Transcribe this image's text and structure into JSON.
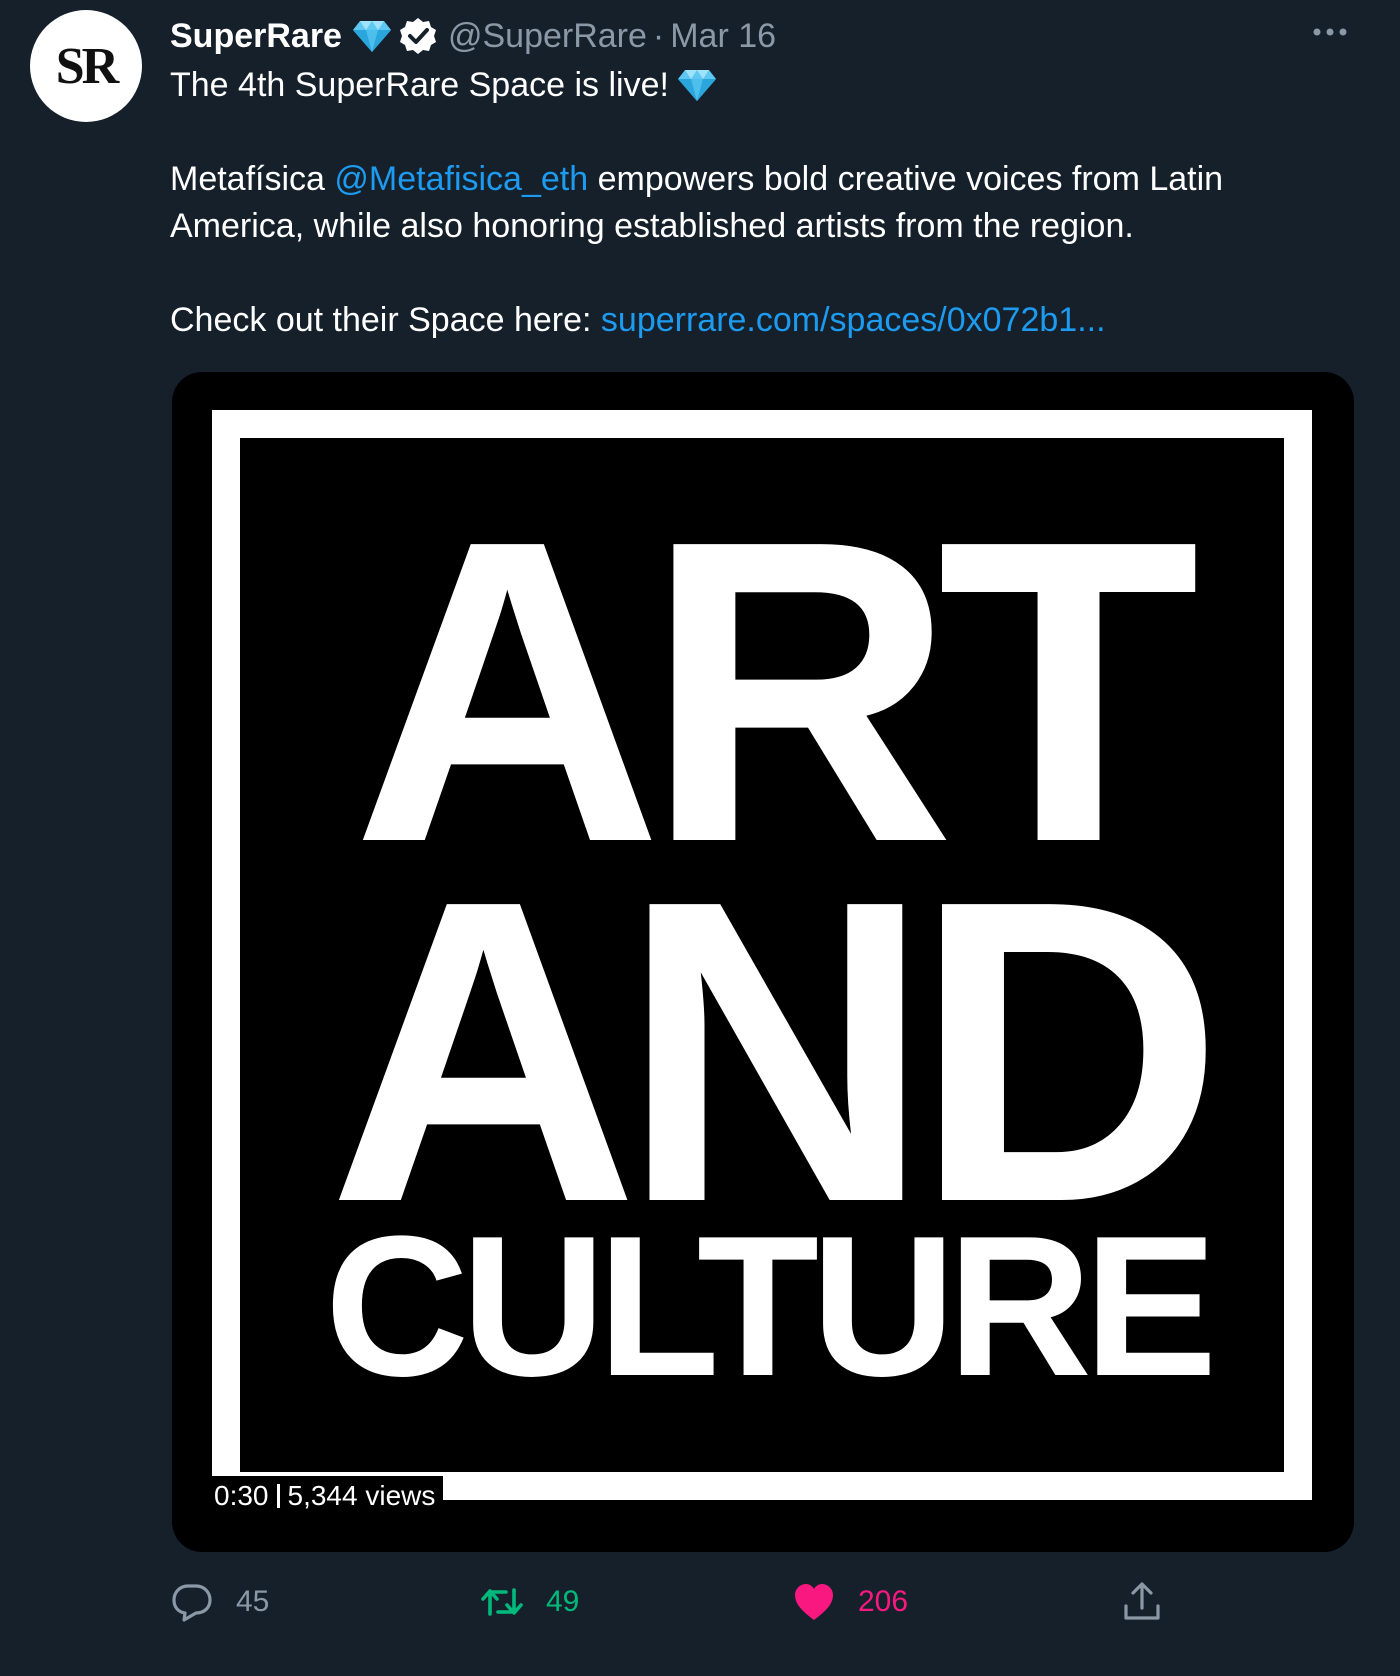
{
  "tweet": {
    "avatar_text": "SR",
    "display_name": "SuperRare",
    "handle": "@SuperRare",
    "separator": "·",
    "date": "Mar 16",
    "more_icon": "more-horizontal-icon",
    "lines": {
      "line1": "The 4th SuperRare Space is live!",
      "line2_before": "Metafísica ",
      "line2_mention": "@Metafisica_eth",
      "line2_after": " empowers bold creative voices from Latin",
      "line3": "America, while also honoring established artists from the region.",
      "line4_before": "Check out their Space here: ",
      "line4_link": "superrare.com/spaces/0x072b1..."
    },
    "media": {
      "art_line1": "ART",
      "art_line2": "AND",
      "art_line3": "CULTURE",
      "duration": "0:30",
      "views": "5,344 views"
    },
    "actions": {
      "reply_count": "45",
      "retweet_count": "49",
      "like_count": "206"
    },
    "icons": {
      "diamond": "diamond-icon",
      "verified": "verified-badge-icon",
      "reply": "reply-icon",
      "retweet": "retweet-icon",
      "like": "heart-icon",
      "share": "share-icon"
    },
    "colors": {
      "background": "#15202b",
      "link": "#1d9bf0",
      "muted": "#8b98a5",
      "retweet": "#00ba7c",
      "like": "#f91880"
    }
  }
}
